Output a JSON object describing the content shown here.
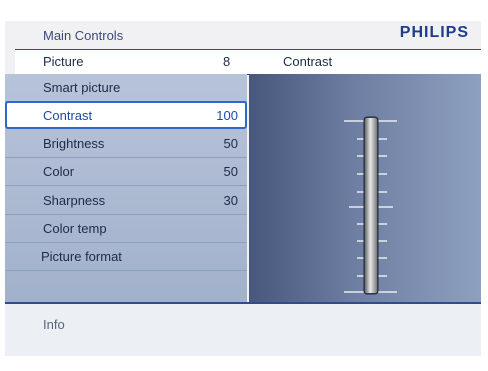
{
  "title": "Main Controls",
  "brand": "PHILIPS",
  "header": {
    "section": "Picture",
    "section_number": "8",
    "detail_title": "Contrast"
  },
  "menu": [
    {
      "label": "Smart picture",
      "value": ""
    },
    {
      "label": "Contrast",
      "value": "100",
      "selected": true
    },
    {
      "label": "Brightness",
      "value": "50"
    },
    {
      "label": "Color",
      "value": "50"
    },
    {
      "label": "Sharpness",
      "value": "30"
    },
    {
      "label": "Color temp",
      "value": ""
    },
    {
      "label": "Picture format",
      "value": ""
    }
  ],
  "slider": {
    "name": "Contrast",
    "value": 100,
    "min": 0,
    "max": 100
  },
  "info": "Info",
  "colors": {
    "accent": "#2d69c8",
    "brand": "#1c3c8c",
    "menu_bg": "#a2b1cb",
    "panel_bg": "#6d7ea2"
  }
}
